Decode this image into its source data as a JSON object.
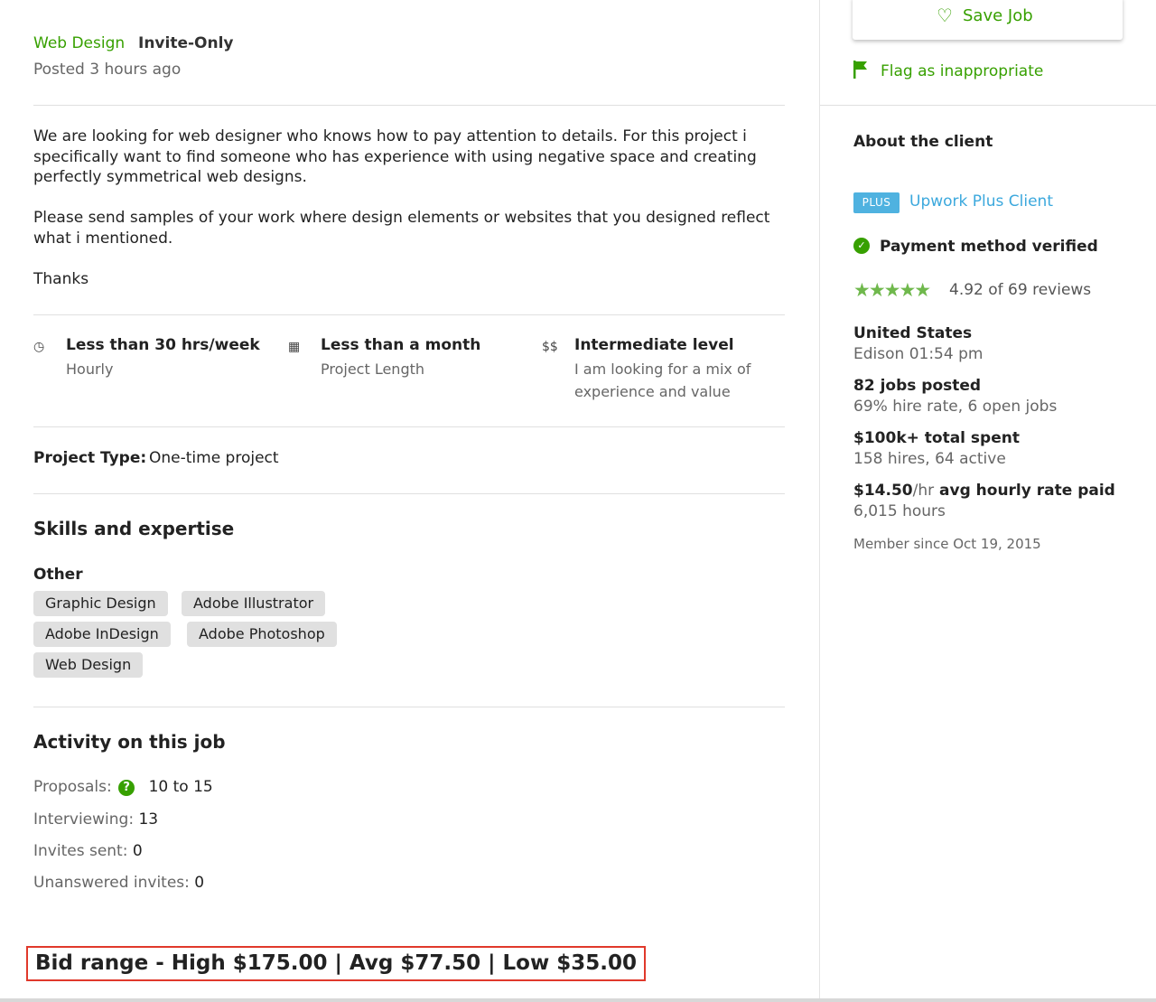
{
  "header": {
    "category": "Web Design",
    "badge": "Invite-Only",
    "posted": "Posted 3 hours ago"
  },
  "description": {
    "para1": "We are looking for web designer who knows how to pay attention to details. For this project i specifically want to find someone who has experience with using negative space and creating perfectly symmetrical web designs.",
    "para2": "Please send samples of your work where design elements or websites that you designed reflect what i mentioned.",
    "para3": "Thanks"
  },
  "features": [
    {
      "icon": "clock-icon",
      "glyph": "◷",
      "title": "Less than 30 hrs/week",
      "subtitle": "Hourly"
    },
    {
      "icon": "calendar-icon",
      "glyph": "▦",
      "title": "Less than a month",
      "subtitle": "Project Length"
    },
    {
      "icon": "dollar-icon",
      "glyph": "$$",
      "title": "Intermediate level",
      "subtitle": "I am looking for a mix of experience and value"
    }
  ],
  "project_type": {
    "label": "Project Type:",
    "value": "One-time project"
  },
  "skills": {
    "heading": "Skills and expertise",
    "group": "Other",
    "items": [
      "Graphic Design",
      "Adobe Illustrator",
      "Adobe InDesign",
      "Adobe Photoshop",
      "Web Design"
    ]
  },
  "activity": {
    "heading": "Activity on this job",
    "proposals_label": "Proposals:",
    "proposals_value": "10 to 15",
    "interviewing_label": "Interviewing:",
    "interviewing_value": "13",
    "invites_label": "Invites sent:",
    "invites_value": "0",
    "unanswered_label": "Unanswered invites:",
    "unanswered_value": "0"
  },
  "bid_range": "Bid range - High $175.00 | Avg $77.50 | Low $35.00",
  "sidebar": {
    "save_job": "Save Job",
    "flag": "Flag as inappropriate",
    "about_heading": "About the client",
    "plus_badge": "PLUS",
    "plus_client": "Upwork Plus Client",
    "payment": "Payment method verified",
    "stars": "★★★★★",
    "rating": "4.92 of 69 reviews",
    "rating_value": 4.92,
    "country": "United States",
    "city_time": "Edison 01:54 pm",
    "jobs_posted": "82 jobs posted",
    "hire_rate": "69% hire rate, 6 open jobs",
    "total_spent": "$100k+ total spent",
    "hires": "158 hires, 64 active",
    "avg_rate_amount": "$14.50",
    "avg_rate_unit": "/hr",
    "avg_rate_label": " avg hourly rate paid",
    "hours": "6,015 hours",
    "member_since": "Member since Oct 19, 2015"
  },
  "colors": {
    "accent_green": "#37a000",
    "plus_blue": "#4fb2e0",
    "link_blue": "#3ba8dd",
    "highlight_red": "#e0392b",
    "tag_bg": "#e0e0e0"
  }
}
